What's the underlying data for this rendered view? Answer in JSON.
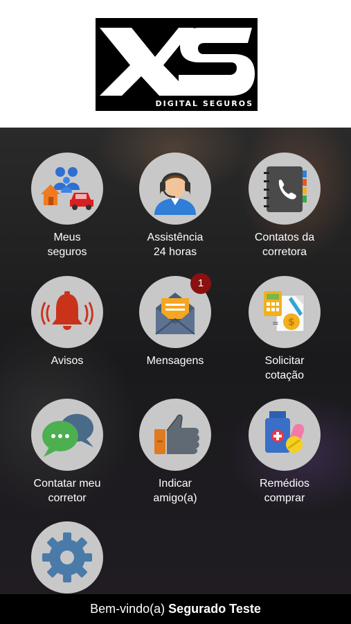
{
  "logo": {
    "mark": "XS",
    "subtitle": "DIGITAL SEGUROS"
  },
  "menu": [
    {
      "label": "Meus\nseguros",
      "icon": "family-house-car-icon"
    },
    {
      "label": "Assistência\n24 horas",
      "icon": "headset-operator-icon"
    },
    {
      "label": "Contatos da\ncorretora",
      "icon": "phonebook-icon"
    },
    {
      "label": "Avisos",
      "icon": "bell-icon"
    },
    {
      "label": "Mensagens",
      "icon": "envelope-icon",
      "badge": "1"
    },
    {
      "label": "Solicitar\ncotação",
      "icon": "calculator-invoice-icon"
    },
    {
      "label": "Contatar meu\ncorretor",
      "icon": "chat-bubbles-icon"
    },
    {
      "label": "Indicar\namigo(a)",
      "icon": "thumbs-up-icon"
    },
    {
      "label": "Remédios\ncomprar",
      "icon": "medicine-icon"
    },
    {
      "label": "",
      "icon": "gear-icon"
    }
  ],
  "footer": {
    "greeting": "Bem-vindo(a)",
    "user_name": "Segurado Teste"
  },
  "colors": {
    "tile_bg": "#c8c8c8",
    "badge": "#8b1010",
    "footer_bg": "#000000"
  }
}
